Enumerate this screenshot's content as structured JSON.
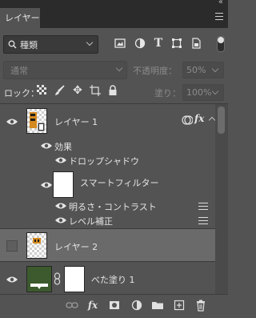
{
  "panel": {
    "collapse_glyph": "«",
    "tab_label": "レイヤー",
    "menu_icon": "hamburger-icon"
  },
  "filter": {
    "kind_label": "種類",
    "icons": [
      "image-filter-icon",
      "adjustment-filter-icon",
      "type-filter-icon",
      "shape-filter-icon",
      "smart-object-filter-icon"
    ]
  },
  "blend": {
    "mode": "通常",
    "opacity_label": "不透明度：",
    "opacity_value": "50%"
  },
  "lock": {
    "label": "ロック：",
    "fill_label": "塗り：",
    "fill_value": "100%"
  },
  "layers": {
    "layer1": {
      "name": "レイヤー 1",
      "effects_label": "効果",
      "effect_drop_shadow": "ドロップシャドウ",
      "smart_filter_label": "スマートフィルター",
      "filter_brightness": "明るさ・コントラスト",
      "filter_levels": "レベル補正",
      "fx_label": "fx"
    },
    "layer2": {
      "name": "レイヤー 2"
    },
    "fill_layer": {
      "name": "べた塗り 1"
    }
  },
  "bottom": {
    "fx_label": "fx",
    "icons": [
      "link-layers-icon",
      "add-style-icon",
      "add-mask-icon",
      "new-adjustment-icon",
      "new-group-icon",
      "new-layer-icon",
      "delete-layer-icon"
    ]
  },
  "colors": {
    "panel_bg": "#535353",
    "selected_row": "#6a6a6a",
    "fill_thumb": "#3c5a2e"
  }
}
